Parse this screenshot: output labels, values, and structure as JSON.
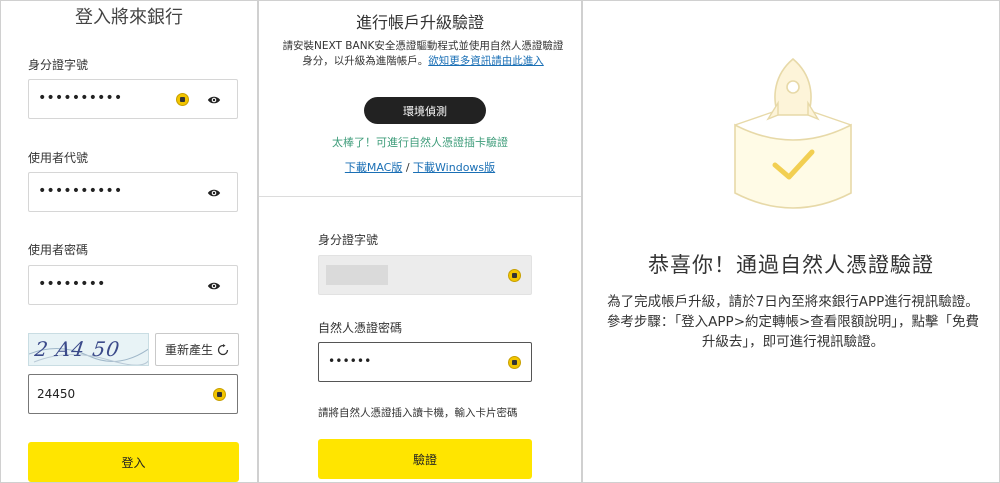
{
  "login": {
    "title": "登入將來銀行",
    "id_label": "身分證字號",
    "id_value": "••••••••••",
    "user_label": "使用者代號",
    "user_value": "••••••••••",
    "pwd_label": "使用者密碼",
    "pwd_value": "••••••••",
    "captcha_text": "2 A4 50",
    "refresh_label": "重新產生",
    "captcha_input_value": "24450",
    "login_button": "登入"
  },
  "upgrade": {
    "title": "進行帳戶升級驗證",
    "desc": "請安裝NEXT BANK安全憑證驅動程式並使用自然人憑證驗證身分，以升級為進階帳戶。",
    "desc_link": "欲知更多資訊請由此進入",
    "env_button": "環境偵測",
    "success_text": "太棒了！可進行自然人憑證插卡驗證",
    "download_mac": "下載MAC版",
    "download_sep": " / ",
    "download_windows": "下載Windows版",
    "id_label": "身分證字號",
    "cert_pwd_label": "自然人憑證密碼",
    "cert_pwd_value": "••••••",
    "hint": "請將自然人憑證插入讀卡機，輸入卡片密碼",
    "verify_button": "驗證"
  },
  "result": {
    "headline": "恭喜你！通過自然人憑證驗證",
    "body": "為了完成帳戶升級，請於7日內至將來銀行APP進行視訊驗證。參考步驟：「登入APP>約定轉帳>查看限額說明」，點擊「免費升級去」，即可進行視訊驗證。"
  },
  "colors": {
    "brand_yellow": "#ffe500",
    "dark_button": "#222222",
    "success_green": "#3e9c7a",
    "link_blue": "#1a6fb5"
  }
}
